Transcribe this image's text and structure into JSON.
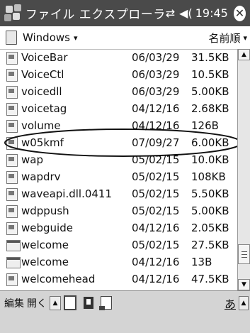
{
  "titlebar": {
    "title": "ファイル エクスプローラ",
    "connectivity_icon": "⇄",
    "volume_icon": "◀(",
    "time": "19:45",
    "close_label": "✕"
  },
  "folderbar": {
    "folder": "Windows",
    "folder_caret": "▾",
    "sort_label": "名前順",
    "sort_caret": "▾"
  },
  "files": [
    {
      "name": "VoiceBar",
      "date": "06/03/29",
      "size": "31.5KB",
      "icon": "app-file-icon"
    },
    {
      "name": "VoiceCtl",
      "date": "06/03/29",
      "size": "10.5KB",
      "icon": "app-file-icon"
    },
    {
      "name": "voicedll",
      "date": "06/03/29",
      "size": "5.00KB",
      "icon": "app-file-icon"
    },
    {
      "name": "voicetag",
      "date": "04/12/16",
      "size": "2.68KB",
      "icon": "app-file-icon"
    },
    {
      "name": "volume",
      "date": "04/12/16",
      "size": "126B",
      "icon": "app-file-icon"
    },
    {
      "name": "w05kmf",
      "date": "07/09/27",
      "size": "6.00KB",
      "icon": "app-file-icon"
    },
    {
      "name": "wap",
      "date": "05/02/15",
      "size": "10.0KB",
      "icon": "app-file-icon"
    },
    {
      "name": "wapdrv",
      "date": "05/02/15",
      "size": "108KB",
      "icon": "app-file-icon"
    },
    {
      "name": "waveapi.dll.0411",
      "date": "05/02/15",
      "size": "5.50KB",
      "icon": "app-file-icon"
    },
    {
      "name": "wdppush",
      "date": "05/02/15",
      "size": "5.00KB",
      "icon": "app-file-icon"
    },
    {
      "name": "webguide",
      "date": "04/12/16",
      "size": "2.05KB",
      "icon": "app-file-icon"
    },
    {
      "name": "welcome",
      "date": "05/02/15",
      "size": "27.5KB",
      "icon": "window-file-icon"
    },
    {
      "name": "welcome",
      "date": "04/12/16",
      "size": "13B",
      "icon": "window-file-icon"
    },
    {
      "name": "welcomehead",
      "date": "04/12/16",
      "size": "47.5KB",
      "icon": "app-file-icon"
    }
  ],
  "highlighted_file": "w05kmf",
  "scroll_position_fraction": 0.85,
  "menubar": {
    "edit_label": "編集",
    "open_label": "開く",
    "ime_label": "あ"
  }
}
